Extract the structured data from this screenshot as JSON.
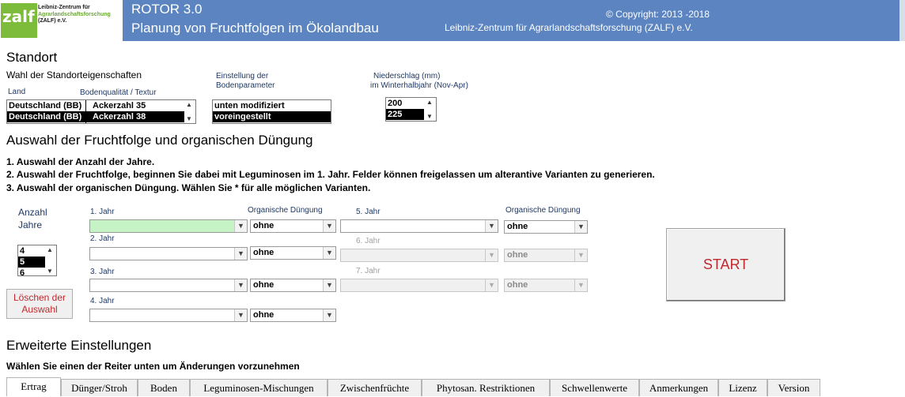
{
  "header": {
    "logo_word": "zalf",
    "logo_lines": [
      "Leibniz-Zentrum für",
      "Agrarlandschaftsforschung",
      "(ZALF) e.V."
    ],
    "title": "ROTOR  3.0",
    "subtitle": "Planung von Fruchtfolgen im Ökolandbau",
    "copyright": "© Copyright: 2013 -2018",
    "institute": "Leibniz-Zentrum für Agrarlandschaftsforschung (ZALF) e.V.",
    "bg_color": "#5b84c0"
  },
  "standort": {
    "heading": "Standort",
    "subheading": "Wahl der Standorteigenschaften",
    "land_label": "Land",
    "boden_label": "Bodenqualität / Textur",
    "site_list": [
      {
        "land": "Deutschland (BB)",
        "boden": "Ackerzahl 35",
        "selected": false
      },
      {
        "land": "Deutschland (BB)",
        "boden": "Ackerzahl 38",
        "selected": true
      }
    ],
    "bodenparam_label_1": "Einstellung der",
    "bodenparam_label_2": "Bodenparameter",
    "bodenparam_list": [
      {
        "label": "unten modifiziert",
        "selected": false
      },
      {
        "label": "voreingestellt",
        "selected": true
      }
    ],
    "niederschlag_label_1": "Niederschlag (mm)",
    "niederschlag_label_2": "im Winterhalbjahr (Nov-Apr)",
    "niederschlag_list": [
      {
        "label": "200",
        "selected": false
      },
      {
        "label": "225",
        "selected": true
      }
    ]
  },
  "fruchtfolge": {
    "heading": "Auswahl der Fruchtfolge und organischen Düngung",
    "instructions": [
      "1. Auswahl der Anzahl der Jahre.",
      "2. Auswahl der Fruchtfolge, beginnen Sie dabei mit Leguminosen im 1. Jahr. Felder können freigelassen um alterantive Varianten zu generieren.",
      "3. Auswahl der organischen Düngung. Wählen Sie * für alle möglichen Varianten."
    ],
    "anzahl_label_1": "Anzahl",
    "anzahl_label_2": "Jahre",
    "anzahl_list": [
      {
        "label": "4",
        "selected": false
      },
      {
        "label": "5",
        "selected": true
      },
      {
        "label": "6",
        "selected": false
      }
    ],
    "clear_button_1": "Löschen der",
    "clear_button_2": "Auswahl",
    "start_button": "START",
    "duengung_label": "Organische Düngung",
    "years": [
      {
        "label": "1. Jahr",
        "crop": "",
        "duengung": "ohne",
        "enabled": true
      },
      {
        "label": "2. Jahr",
        "crop": "",
        "duengung": "ohne",
        "enabled": true
      },
      {
        "label": "3. Jahr",
        "crop": "",
        "duengung": "ohne",
        "enabled": true
      },
      {
        "label": "4. Jahr",
        "crop": "",
        "duengung": "ohne",
        "enabled": true
      },
      {
        "label": "5. Jahr",
        "crop": "",
        "duengung": "ohne",
        "enabled": true
      },
      {
        "label": "6. Jahr",
        "crop": "",
        "duengung": "ohne",
        "enabled": false
      },
      {
        "label": "7. Jahr",
        "crop": "",
        "duengung": "ohne",
        "enabled": false
      }
    ]
  },
  "erweitert": {
    "heading": "Erweiterte Einstellungen",
    "instruction": "Wählen Sie einen der Reiter unten um Änderungen vorzunehmen",
    "tabs": [
      "Ertrag",
      "Dünger/Stroh",
      "Boden",
      "Leguminosen-Mischungen",
      "Zwischenfrüchte",
      "Phytosan. Restriktionen",
      "Schwellenwerte",
      "Anmerkungen",
      "Lizenz",
      "Version"
    ],
    "active_tab": "Ertrag"
  },
  "colors": {
    "accent_red": "#c0282d",
    "label_blue": "#1f3864",
    "active_crop_field": "#c6f3c6"
  }
}
